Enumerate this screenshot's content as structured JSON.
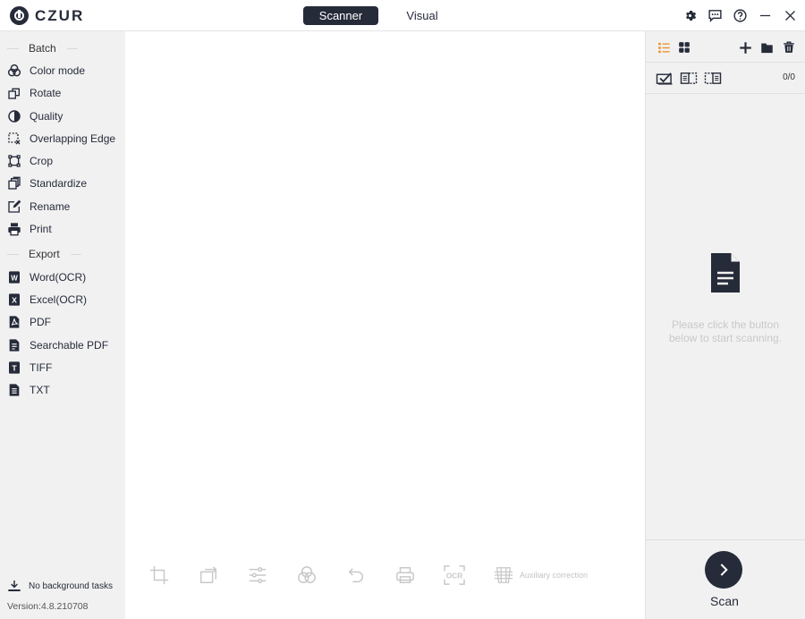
{
  "app": {
    "brand": "CZUR"
  },
  "mode_tabs": [
    {
      "label": "Scanner",
      "active": true
    },
    {
      "label": "Visual",
      "active": false
    }
  ],
  "window_controls": [
    "settings-icon",
    "feedback-icon",
    "help-icon",
    "minimize-icon",
    "close-icon"
  ],
  "sidebar": {
    "batch_heading": "Batch",
    "batch_items": [
      {
        "label": "Color mode",
        "icon": "color-mode-icon"
      },
      {
        "label": "Rotate",
        "icon": "rotate-icon"
      },
      {
        "label": "Quality",
        "icon": "quality-icon"
      },
      {
        "label": "Overlapping Edge",
        "icon": "overlapping-edge-icon"
      },
      {
        "label": "Crop",
        "icon": "crop-icon"
      },
      {
        "label": "Standardize",
        "icon": "standardize-icon"
      },
      {
        "label": "Rename",
        "icon": "rename-icon"
      },
      {
        "label": "Print",
        "icon": "print-icon"
      }
    ],
    "export_heading": "Export",
    "export_items": [
      {
        "label": "Word(OCR)",
        "icon": "word-icon"
      },
      {
        "label": "Excel(OCR)",
        "icon": "excel-icon"
      },
      {
        "label": "PDF",
        "icon": "pdf-icon"
      },
      {
        "label": "Searchable PDF",
        "icon": "searchable-pdf-icon"
      },
      {
        "label": "TIFF",
        "icon": "tiff-icon"
      },
      {
        "label": "TXT",
        "icon": "txt-icon"
      }
    ],
    "background_tasks": "No background tasks",
    "version": "Version:4.8.210708"
  },
  "toolbar": {
    "icons": [
      "crop-tool-icon",
      "rotate-tool-icon",
      "adjust-tool-icon",
      "color-tool-icon",
      "undo-tool-icon",
      "print-tool-icon",
      "ocr-tool-icon",
      "auxiliary-correction-icon"
    ],
    "ocr_text": "OCR",
    "auxiliary_label": "Auxiliary correction"
  },
  "right_panel": {
    "count": "0/0",
    "empty_message": "Please click the button below to start scanning.",
    "scan_label": "Scan",
    "accent": "#f08a1c"
  }
}
